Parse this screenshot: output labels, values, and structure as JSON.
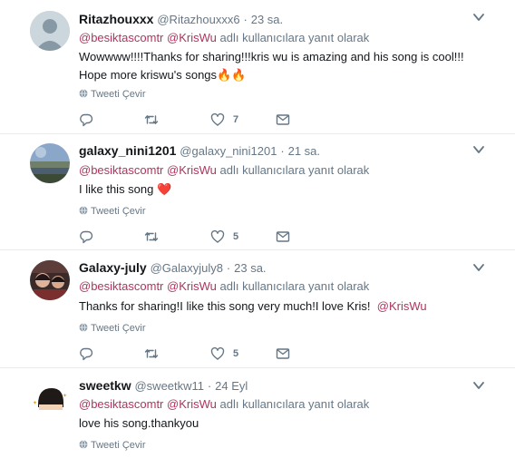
{
  "tweets": [
    {
      "name": "Ritazhouxxx",
      "handle": "@Ritazhouxxx6",
      "sep": "·",
      "time": "23 sa.",
      "mention1": "@besiktascomtr",
      "mention2": "@KrisWu",
      "reply_suffix": "adlı kullanıcılara yanıt olarak",
      "text": "Wowwww!!!!Thanks for sharing!!!kris wu is amazing and his song is cool!!! Hope more kriswu's songs🔥🔥",
      "translate": "Tweeti Çevir",
      "likes": "7",
      "avatar": "default"
    },
    {
      "name": "galaxy_nini1201",
      "handle": "@galaxy_nini1201",
      "sep": "·",
      "time": "21 sa.",
      "mention1": "@besiktascomtr",
      "mention2": "@KrisWu",
      "reply_suffix": "adlı kullanıcılara yanıt olarak",
      "text": "I like this song ❤️",
      "translate": "Tweeti Çevir",
      "likes": "5",
      "avatar": "landscape"
    },
    {
      "name": "Galaxy-july",
      "handle": "@Galaxyjuly8",
      "sep": "·",
      "time": "23 sa.",
      "mention1": "@besiktascomtr",
      "mention2": "@KrisWu",
      "reply_suffix": "adlı kullanıcılara yanıt olarak",
      "text": "Thanks for sharing!I like this song very much!I love Kris!",
      "text_mention": "@KrisWu",
      "translate": "Tweeti Çevir",
      "likes": "5",
      "avatar": "photo"
    },
    {
      "name": "sweetkw",
      "handle": "@sweetkw11",
      "sep": "·",
      "time": "24 Eyl",
      "mention1": "@besiktascomtr",
      "mention2": "@KrisWu",
      "reply_suffix": "adlı kullanıcılara yanıt olarak",
      "text": "love his song.thankyou",
      "translate": "Tweeti Çevir",
      "avatar": "cartoon"
    }
  ],
  "icons": {
    "reply": "reply-icon",
    "retweet": "retweet-icon",
    "like": "heart-icon",
    "dm": "envelope-icon",
    "caret": "chevron-down-icon",
    "globe": "globe-icon"
  },
  "colors": {
    "mention": "#b0345c",
    "secondary": "#657786",
    "divider": "#e6ecf0"
  }
}
